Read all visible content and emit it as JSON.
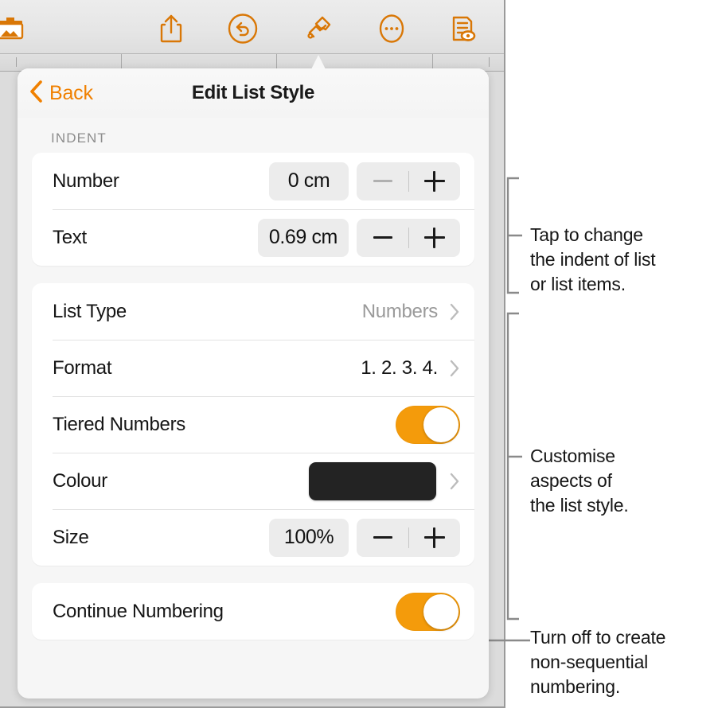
{
  "toolbar": {
    "icons": [
      {
        "name": "media-image-icon",
        "label": "Insert Media"
      },
      {
        "name": "share-icon",
        "label": "Share"
      },
      {
        "name": "undo-icon",
        "label": "Undo"
      },
      {
        "name": "format-brush-icon",
        "label": "Format"
      },
      {
        "name": "more-ellipsis-icon",
        "label": "More"
      },
      {
        "name": "document-view-icon",
        "label": "Document Options"
      }
    ],
    "accent_color": "#d97706"
  },
  "popover": {
    "back_label": "Back",
    "title": "Edit List Style",
    "section_indent_label": "INDENT",
    "indent_rows": [
      {
        "label": "Number",
        "value": "0 cm",
        "minus_disabled": true
      },
      {
        "label": "Text",
        "value": "0.69 cm",
        "minus_disabled": false
      }
    ],
    "style_rows": [
      {
        "label": "List Type",
        "value": "Numbers",
        "kind": "disclosure"
      },
      {
        "label": "Format",
        "value": "1. 2. 3. 4.",
        "kind": "disclosure"
      },
      {
        "label": "Tiered Numbers",
        "value": "on",
        "kind": "toggle"
      },
      {
        "label": "Colour",
        "value": "#232323",
        "kind": "colour"
      },
      {
        "label": "Size",
        "value": "100%",
        "kind": "stepper",
        "minus_disabled": false
      }
    ],
    "continue_row": {
      "label": "Continue Numbering",
      "value": "on"
    },
    "accent_color": "#f49b0b"
  },
  "annotations": [
    {
      "name": "indent-callout",
      "text": "Tap to change the indent of list or list items."
    },
    {
      "name": "style-callout",
      "text": "Customise aspects of the list style."
    },
    {
      "name": "continue-callout",
      "text": "Turn off to create non-sequential numbering."
    }
  ],
  "annotation_lines": {
    "indent": [
      "Tap to change",
      "the indent of list",
      "or list items."
    ],
    "style": [
      "Customise",
      "aspects of",
      "the list style."
    ],
    "continue": [
      "Turn off to create",
      "non-sequential",
      "numbering."
    ]
  }
}
